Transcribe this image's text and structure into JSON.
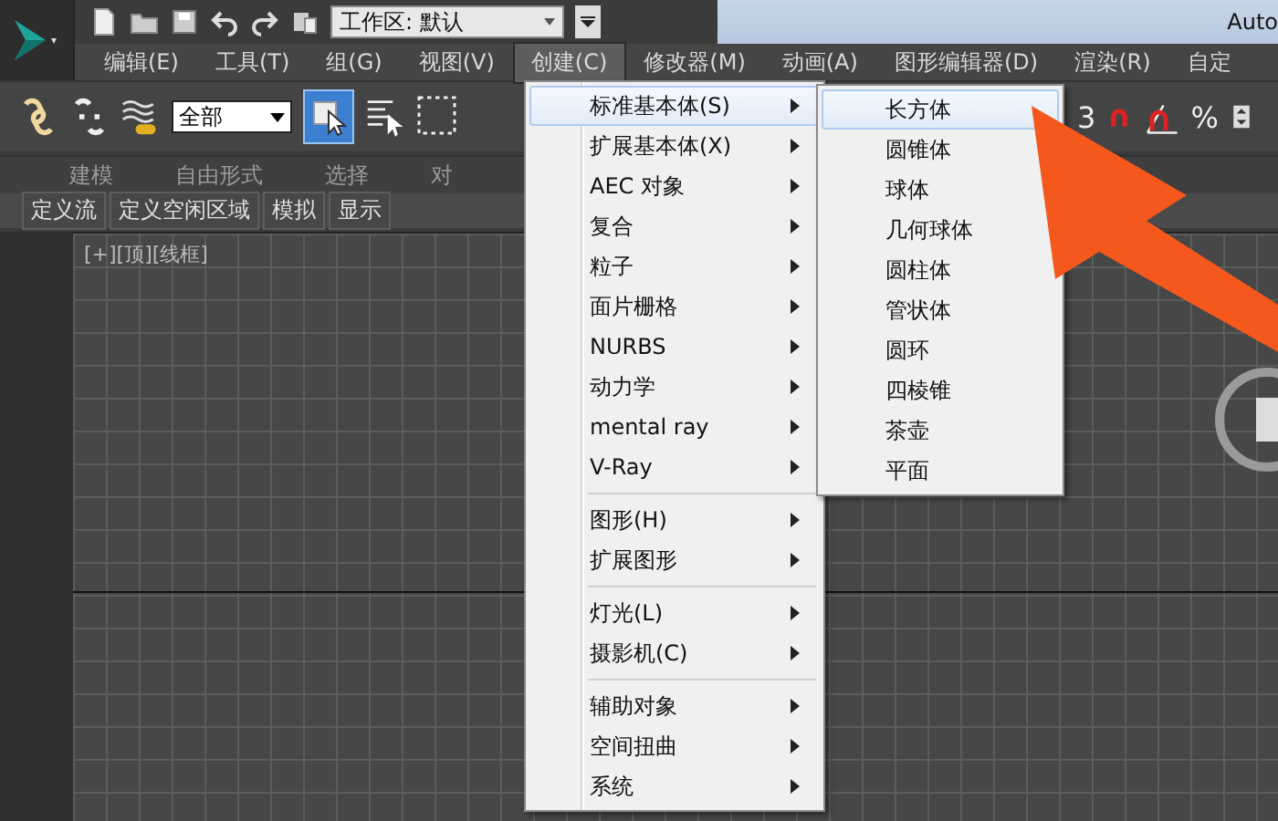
{
  "title_bar": {
    "workspace": "工作区: 默认",
    "app_title": "Auto"
  },
  "menu_bar": [
    {
      "label": "编辑(E)",
      "selected": false
    },
    {
      "label": "工具(T)",
      "selected": false
    },
    {
      "label": "组(G)",
      "selected": false
    },
    {
      "label": "视图(V)",
      "selected": false
    },
    {
      "label": "创建(C)",
      "selected": true
    },
    {
      "label": "修改器(M)",
      "selected": false
    },
    {
      "label": "动画(A)",
      "selected": false
    },
    {
      "label": "图形编辑器(D)",
      "selected": false
    },
    {
      "label": "渲染(R)",
      "selected": false
    },
    {
      "label": "自定",
      "selected": false
    }
  ],
  "toolbar": {
    "selection_filter": "全部",
    "snap_label": "3",
    "percent_snap_label": "%"
  },
  "ribbon_tabs": [
    "建模",
    "自由形式",
    "选择",
    "对"
  ],
  "ribbon_subtabs": [
    "定义流",
    "定义空闲区域",
    "模拟",
    "显示"
  ],
  "viewport": {
    "label": "[+][顶][线框]"
  },
  "create_menu": {
    "groups": [
      [
        {
          "label": "标准基本体(S)",
          "selected": true
        },
        {
          "label": "扩展基本体(X)",
          "selected": false
        },
        {
          "label": "AEC 对象",
          "selected": false
        },
        {
          "label": "复合",
          "selected": false
        },
        {
          "label": "粒子",
          "selected": false
        },
        {
          "label": "面片栅格",
          "selected": false
        },
        {
          "label": "NURBS",
          "selected": false
        },
        {
          "label": "动力学",
          "selected": false
        },
        {
          "label": "mental ray",
          "selected": false
        },
        {
          "label": "V-Ray",
          "selected": false
        }
      ],
      [
        {
          "label": "图形(H)",
          "selected": false
        },
        {
          "label": "扩展图形",
          "selected": false
        }
      ],
      [
        {
          "label": "灯光(L)",
          "selected": false
        },
        {
          "label": "摄影机(C)",
          "selected": false
        }
      ],
      [
        {
          "label": "辅助对象",
          "selected": false
        },
        {
          "label": "空间扭曲",
          "selected": false
        },
        {
          "label": "系统",
          "selected": false
        }
      ]
    ]
  },
  "submenu": [
    {
      "label": "长方体",
      "selected": true
    },
    {
      "label": "圆锥体",
      "selected": false
    },
    {
      "label": "球体",
      "selected": false
    },
    {
      "label": "几何球体",
      "selected": false
    },
    {
      "label": "圆柱体",
      "selected": false
    },
    {
      "label": "管状体",
      "selected": false
    },
    {
      "label": "圆环",
      "selected": false
    },
    {
      "label": "四棱锥",
      "selected": false
    },
    {
      "label": "茶壶",
      "selected": false
    },
    {
      "label": "平面",
      "selected": false
    }
  ]
}
